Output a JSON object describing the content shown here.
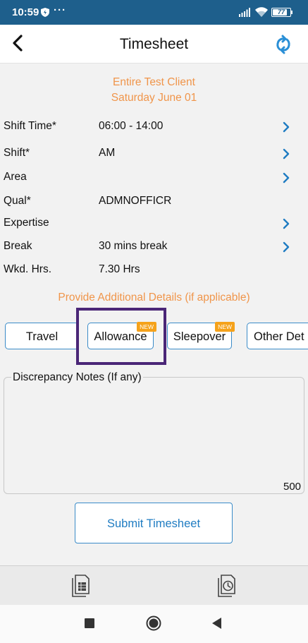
{
  "status_bar": {
    "time": "10:59",
    "dots": "···",
    "battery_level": "77",
    "icons": [
      "shield-icon",
      "signal-icon",
      "wifi-icon",
      "battery-icon"
    ]
  },
  "header": {
    "title": "Timesheet",
    "back_icon": "chevron-left-icon",
    "refresh_icon": "refresh-icon"
  },
  "client": {
    "name": "Entire Test Client",
    "date": "Saturday June 01"
  },
  "details": [
    {
      "label": "Shift Time*",
      "value": "06:00 - 14:00",
      "has_chevron": true
    },
    {
      "label": "Shift*",
      "value": "AM",
      "has_chevron": true
    },
    {
      "label": "Area",
      "value": "",
      "has_chevron": true
    },
    {
      "label": "Qual*",
      "value": "ADMNOFFICR",
      "has_chevron": false
    },
    {
      "label": "Expertise",
      "value": "",
      "has_chevron": true
    },
    {
      "label": "Break",
      "value": "30 mins break",
      "has_chevron": true
    },
    {
      "label": "Wkd. Hrs.",
      "value": "7.30 Hrs",
      "has_chevron": false
    }
  ],
  "additional_details": "Provide Additional Details (if applicable)",
  "tabs": [
    {
      "label": "Travel",
      "badge": ""
    },
    {
      "label": "Allowance",
      "badge": "NEW"
    },
    {
      "label": "Sleepover",
      "badge": "NEW"
    },
    {
      "label": "Other Det",
      "badge": ""
    }
  ],
  "notes": {
    "label": "Discrepancy Notes (If any)",
    "value": "",
    "remaining": "500"
  },
  "submit_label": "Submit Timesheet",
  "bottom_tabs": [
    "timesheet-list-icon",
    "timesheet-history-icon"
  ],
  "colors": {
    "status_bar": "#1e5f8c",
    "accent_orange": "#f0954a",
    "accent_blue": "#1f7cc2",
    "badge": "#f5a21b",
    "highlight": "#4a2677"
  }
}
